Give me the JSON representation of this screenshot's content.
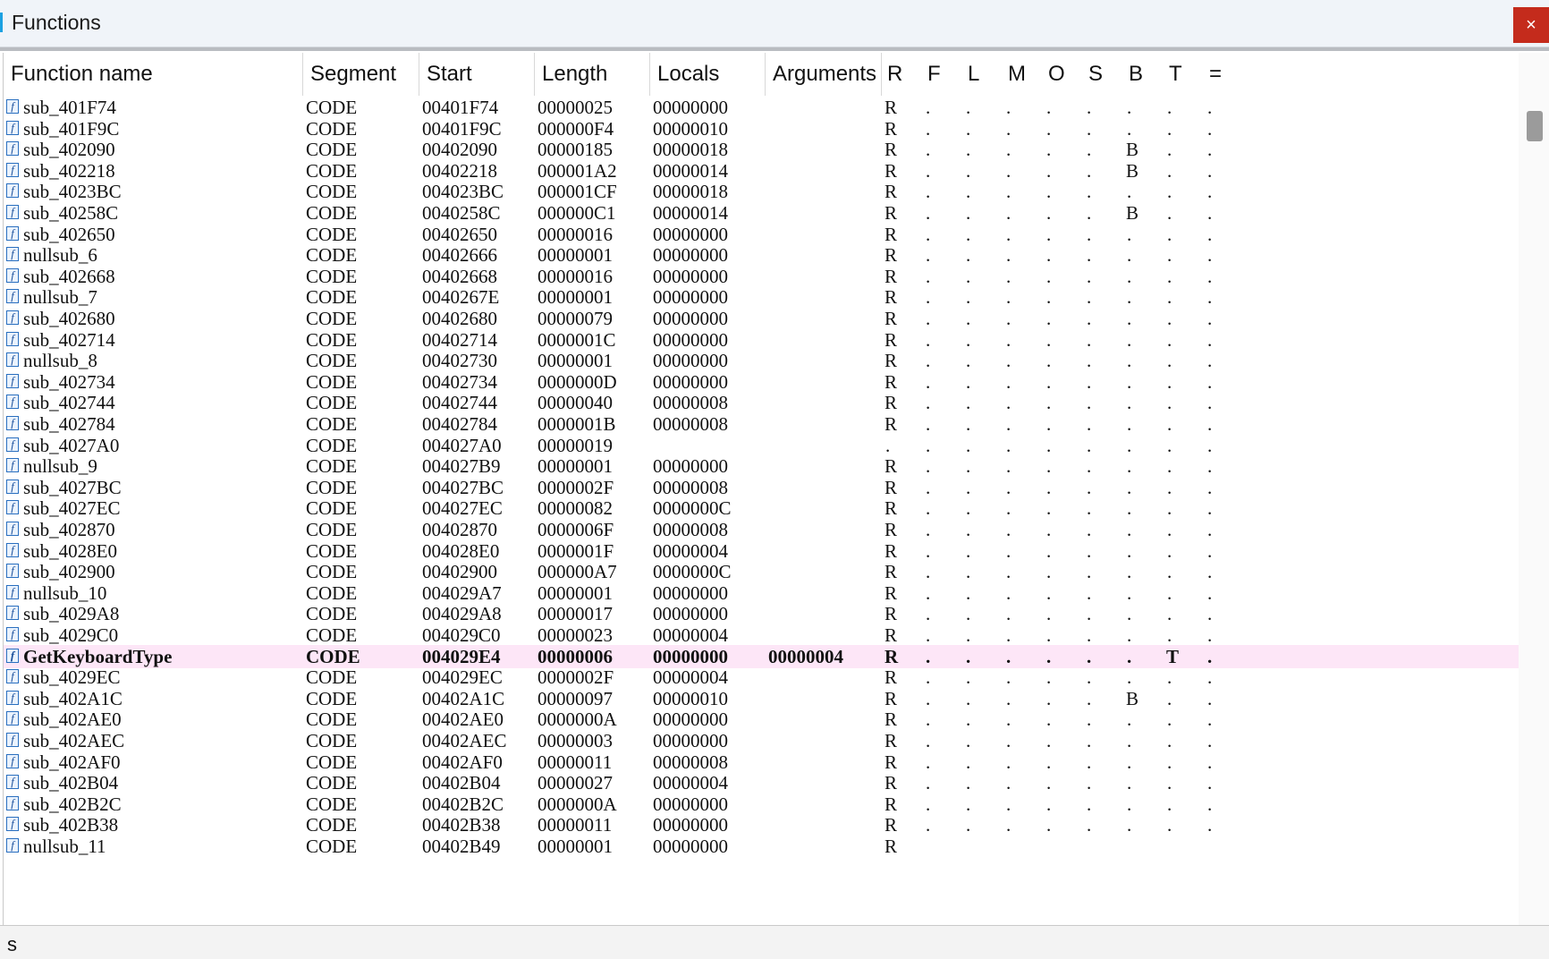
{
  "window": {
    "title": "Functions",
    "close_label": "×"
  },
  "columns": [
    "Function name",
    "Segment",
    "Start",
    "Length",
    "Locals",
    "Arguments",
    "R",
    "F",
    "L",
    "M",
    "O",
    "S",
    "B",
    "T",
    "="
  ],
  "rows": [
    {
      "name": "sub_401F74",
      "segment": "CODE",
      "start": "00401F74",
      "length": "00000025",
      "locals": "00000000",
      "args": "",
      "flags": [
        "R",
        ".",
        ".",
        ".",
        ".",
        ".",
        ".",
        ".",
        "."
      ]
    },
    {
      "name": "sub_401F9C",
      "segment": "CODE",
      "start": "00401F9C",
      "length": "000000F4",
      "locals": "00000010",
      "args": "",
      "flags": [
        "R",
        ".",
        ".",
        ".",
        ".",
        ".",
        ".",
        ".",
        "."
      ]
    },
    {
      "name": "sub_402090",
      "segment": "CODE",
      "start": "00402090",
      "length": "00000185",
      "locals": "00000018",
      "args": "",
      "flags": [
        "R",
        ".",
        ".",
        ".",
        ".",
        ".",
        "B",
        ".",
        "."
      ]
    },
    {
      "name": "sub_402218",
      "segment": "CODE",
      "start": "00402218",
      "length": "000001A2",
      "locals": "00000014",
      "args": "",
      "flags": [
        "R",
        ".",
        ".",
        ".",
        ".",
        ".",
        "B",
        ".",
        "."
      ]
    },
    {
      "name": "sub_4023BC",
      "segment": "CODE",
      "start": "004023BC",
      "length": "000001CF",
      "locals": "00000018",
      "args": "",
      "flags": [
        "R",
        ".",
        ".",
        ".",
        ".",
        ".",
        ".",
        ".",
        "."
      ]
    },
    {
      "name": "sub_40258C",
      "segment": "CODE",
      "start": "0040258C",
      "length": "000000C1",
      "locals": "00000014",
      "args": "",
      "flags": [
        "R",
        ".",
        ".",
        ".",
        ".",
        ".",
        "B",
        ".",
        "."
      ]
    },
    {
      "name": "sub_402650",
      "segment": "CODE",
      "start": "00402650",
      "length": "00000016",
      "locals": "00000000",
      "args": "",
      "flags": [
        "R",
        ".",
        ".",
        ".",
        ".",
        ".",
        ".",
        ".",
        "."
      ]
    },
    {
      "name": "nullsub_6",
      "segment": "CODE",
      "start": "00402666",
      "length": "00000001",
      "locals": "00000000",
      "args": "",
      "flags": [
        "R",
        ".",
        ".",
        ".",
        ".",
        ".",
        ".",
        ".",
        "."
      ]
    },
    {
      "name": "sub_402668",
      "segment": "CODE",
      "start": "00402668",
      "length": "00000016",
      "locals": "00000000",
      "args": "",
      "flags": [
        "R",
        ".",
        ".",
        ".",
        ".",
        ".",
        ".",
        ".",
        "."
      ]
    },
    {
      "name": "nullsub_7",
      "segment": "CODE",
      "start": "0040267E",
      "length": "00000001",
      "locals": "00000000",
      "args": "",
      "flags": [
        "R",
        ".",
        ".",
        ".",
        ".",
        ".",
        ".",
        ".",
        "."
      ]
    },
    {
      "name": "sub_402680",
      "segment": "CODE",
      "start": "00402680",
      "length": "00000079",
      "locals": "00000000",
      "args": "",
      "flags": [
        "R",
        ".",
        ".",
        ".",
        ".",
        ".",
        ".",
        ".",
        "."
      ]
    },
    {
      "name": "sub_402714",
      "segment": "CODE",
      "start": "00402714",
      "length": "0000001C",
      "locals": "00000000",
      "args": "",
      "flags": [
        "R",
        ".",
        ".",
        ".",
        ".",
        ".",
        ".",
        ".",
        "."
      ]
    },
    {
      "name": "nullsub_8",
      "segment": "CODE",
      "start": "00402730",
      "length": "00000001",
      "locals": "00000000",
      "args": "",
      "flags": [
        "R",
        ".",
        ".",
        ".",
        ".",
        ".",
        ".",
        ".",
        "."
      ]
    },
    {
      "name": "sub_402734",
      "segment": "CODE",
      "start": "00402734",
      "length": "0000000D",
      "locals": "00000000",
      "args": "",
      "flags": [
        "R",
        ".",
        ".",
        ".",
        ".",
        ".",
        ".",
        ".",
        "."
      ]
    },
    {
      "name": "sub_402744",
      "segment": "CODE",
      "start": "00402744",
      "length": "00000040",
      "locals": "00000008",
      "args": "",
      "flags": [
        "R",
        ".",
        ".",
        ".",
        ".",
        ".",
        ".",
        ".",
        "."
      ]
    },
    {
      "name": "sub_402784",
      "segment": "CODE",
      "start": "00402784",
      "length": "0000001B",
      "locals": "00000008",
      "args": "",
      "flags": [
        "R",
        ".",
        ".",
        ".",
        ".",
        ".",
        ".",
        ".",
        "."
      ]
    },
    {
      "name": "sub_4027A0",
      "segment": "CODE",
      "start": "004027A0",
      "length": "00000019",
      "locals": "",
      "args": "",
      "flags": [
        ".",
        ".",
        ".",
        ".",
        ".",
        ".",
        ".",
        ".",
        "."
      ]
    },
    {
      "name": "nullsub_9",
      "segment": "CODE",
      "start": "004027B9",
      "length": "00000001",
      "locals": "00000000",
      "args": "",
      "flags": [
        "R",
        ".",
        ".",
        ".",
        ".",
        ".",
        ".",
        ".",
        "."
      ]
    },
    {
      "name": "sub_4027BC",
      "segment": "CODE",
      "start": "004027BC",
      "length": "0000002F",
      "locals": "00000008",
      "args": "",
      "flags": [
        "R",
        ".",
        ".",
        ".",
        ".",
        ".",
        ".",
        ".",
        "."
      ]
    },
    {
      "name": "sub_4027EC",
      "segment": "CODE",
      "start": "004027EC",
      "length": "00000082",
      "locals": "0000000C",
      "args": "",
      "flags": [
        "R",
        ".",
        ".",
        ".",
        ".",
        ".",
        ".",
        ".",
        "."
      ]
    },
    {
      "name": "sub_402870",
      "segment": "CODE",
      "start": "00402870",
      "length": "0000006F",
      "locals": "00000008",
      "args": "",
      "flags": [
        "R",
        ".",
        ".",
        ".",
        ".",
        ".",
        ".",
        ".",
        "."
      ]
    },
    {
      "name": "sub_4028E0",
      "segment": "CODE",
      "start": "004028E0",
      "length": "0000001F",
      "locals": "00000004",
      "args": "",
      "flags": [
        "R",
        ".",
        ".",
        ".",
        ".",
        ".",
        ".",
        ".",
        "."
      ]
    },
    {
      "name": "sub_402900",
      "segment": "CODE",
      "start": "00402900",
      "length": "000000A7",
      "locals": "0000000C",
      "args": "",
      "flags": [
        "R",
        ".",
        ".",
        ".",
        ".",
        ".",
        ".",
        ".",
        "."
      ]
    },
    {
      "name": "nullsub_10",
      "segment": "CODE",
      "start": "004029A7",
      "length": "00000001",
      "locals": "00000000",
      "args": "",
      "flags": [
        "R",
        ".",
        ".",
        ".",
        ".",
        ".",
        ".",
        ".",
        "."
      ]
    },
    {
      "name": "sub_4029A8",
      "segment": "CODE",
      "start": "004029A8",
      "length": "00000017",
      "locals": "00000000",
      "args": "",
      "flags": [
        "R",
        ".",
        ".",
        ".",
        ".",
        ".",
        ".",
        ".",
        "."
      ]
    },
    {
      "name": "sub_4029C0",
      "segment": "CODE",
      "start": "004029C0",
      "length": "00000023",
      "locals": "00000004",
      "args": "",
      "flags": [
        "R",
        ".",
        ".",
        ".",
        ".",
        ".",
        ".",
        ".",
        "."
      ]
    },
    {
      "name": "GetKeyboardType",
      "segment": "CODE",
      "start": "004029E4",
      "length": "00000006",
      "locals": "00000000",
      "args": "00000004",
      "flags": [
        "R",
        ".",
        ".",
        ".",
        ".",
        ".",
        ".",
        "T",
        "."
      ],
      "selected": true
    },
    {
      "name": "sub_4029EC",
      "segment": "CODE",
      "start": "004029EC",
      "length": "0000002F",
      "locals": "00000004",
      "args": "",
      "flags": [
        "R",
        ".",
        ".",
        ".",
        ".",
        ".",
        ".",
        ".",
        "."
      ]
    },
    {
      "name": "sub_402A1C",
      "segment": "CODE",
      "start": "00402A1C",
      "length": "00000097",
      "locals": "00000010",
      "args": "",
      "flags": [
        "R",
        ".",
        ".",
        ".",
        ".",
        ".",
        "B",
        ".",
        "."
      ]
    },
    {
      "name": "sub_402AE0",
      "segment": "CODE",
      "start": "00402AE0",
      "length": "0000000A",
      "locals": "00000000",
      "args": "",
      "flags": [
        "R",
        ".",
        ".",
        ".",
        ".",
        ".",
        ".",
        ".",
        "."
      ]
    },
    {
      "name": "sub_402AEC",
      "segment": "CODE",
      "start": "00402AEC",
      "length": "00000003",
      "locals": "00000000",
      "args": "",
      "flags": [
        "R",
        ".",
        ".",
        ".",
        ".",
        ".",
        ".",
        ".",
        "."
      ]
    },
    {
      "name": "sub_402AF0",
      "segment": "CODE",
      "start": "00402AF0",
      "length": "00000011",
      "locals": "00000008",
      "args": "",
      "flags": [
        "R",
        ".",
        ".",
        ".",
        ".",
        ".",
        ".",
        ".",
        "."
      ]
    },
    {
      "name": "sub_402B04",
      "segment": "CODE",
      "start": "00402B04",
      "length": "00000027",
      "locals": "00000004",
      "args": "",
      "flags": [
        "R",
        ".",
        ".",
        ".",
        ".",
        ".",
        ".",
        ".",
        "."
      ]
    },
    {
      "name": "sub_402B2C",
      "segment": "CODE",
      "start": "00402B2C",
      "length": "0000000A",
      "locals": "00000000",
      "args": "",
      "flags": [
        "R",
        ".",
        ".",
        ".",
        ".",
        ".",
        ".",
        ".",
        "."
      ]
    },
    {
      "name": "sub_402B38",
      "segment": "CODE",
      "start": "00402B38",
      "length": "00000011",
      "locals": "00000000",
      "args": "",
      "flags": [
        "R",
        ".",
        ".",
        ".",
        ".",
        ".",
        ".",
        ".",
        "."
      ]
    },
    {
      "name": "nullsub_11",
      "segment": "CODE",
      "start": "00402B49",
      "length": "00000001",
      "locals": "00000000",
      "args": "",
      "flags": [
        "R",
        "",
        "",
        "",
        "",
        "",
        "",
        "",
        ""
      ]
    }
  ],
  "status": {
    "text": "s"
  },
  "colors": {
    "selected_row": "#fde6f7",
    "close_button": "#c42b1c",
    "icon_border": "#2a6fbf"
  },
  "icons": {
    "row_icon": "function-icon"
  }
}
